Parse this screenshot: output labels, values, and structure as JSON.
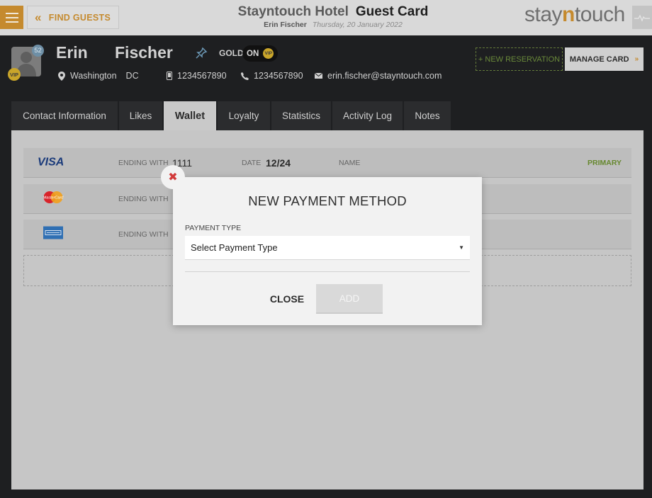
{
  "topbar": {
    "find_guests_label": "FIND GUESTS",
    "hotel_name": "Stayntouch Hotel",
    "page_title": "Guest Card",
    "guest_name": "Erin Fischer",
    "date": "Thursday, 20 January 2022",
    "brand_part1": "stay",
    "brand_part2": "n",
    "brand_part3": "touch"
  },
  "guest": {
    "first_name": "Erin",
    "last_name": "Fischer",
    "avatar_count": "52",
    "vip_badge": "VIP",
    "membership_label": "GOLD",
    "toggle_state": "ON",
    "toggle_vip": "VIP",
    "city": "Washington",
    "state": "DC",
    "mobile": "1234567890",
    "phone": "1234567890",
    "email": "erin.fischer@stayntouch.com"
  },
  "actions": {
    "new_reservation_label": "+ NEW RESERVATION",
    "manage_card_label": "MANAGE CARD"
  },
  "tabs": [
    {
      "label": "Contact Information"
    },
    {
      "label": "Likes"
    },
    {
      "label": "Wallet"
    },
    {
      "label": "Loyalty"
    },
    {
      "label": "Statistics"
    },
    {
      "label": "Activity Log"
    },
    {
      "label": "Notes"
    }
  ],
  "active_tab": "Wallet",
  "wallet": {
    "cards": [
      {
        "brand": "VISA",
        "ending_label": "ENDING WITH",
        "ending": "1111",
        "date_label": "DATE",
        "date": "12/24",
        "name_label": "NAME",
        "primary": "PRIMARY"
      },
      {
        "brand": "MasterCard",
        "ending_label": "ENDING WITH"
      },
      {
        "brand": "American Express",
        "ending_label": "ENDING WITH"
      }
    ]
  },
  "modal": {
    "title": "NEW PAYMENT METHOD",
    "payment_type_label": "PAYMENT TYPE",
    "payment_type_placeholder": "Select Payment Type",
    "close_label": "CLOSE",
    "add_label": "ADD"
  },
  "colors": {
    "accent": "#c58a2e",
    "primary_green": "#66882e",
    "close_red": "#d23a3a",
    "vip_gold": "#c9a52a"
  }
}
